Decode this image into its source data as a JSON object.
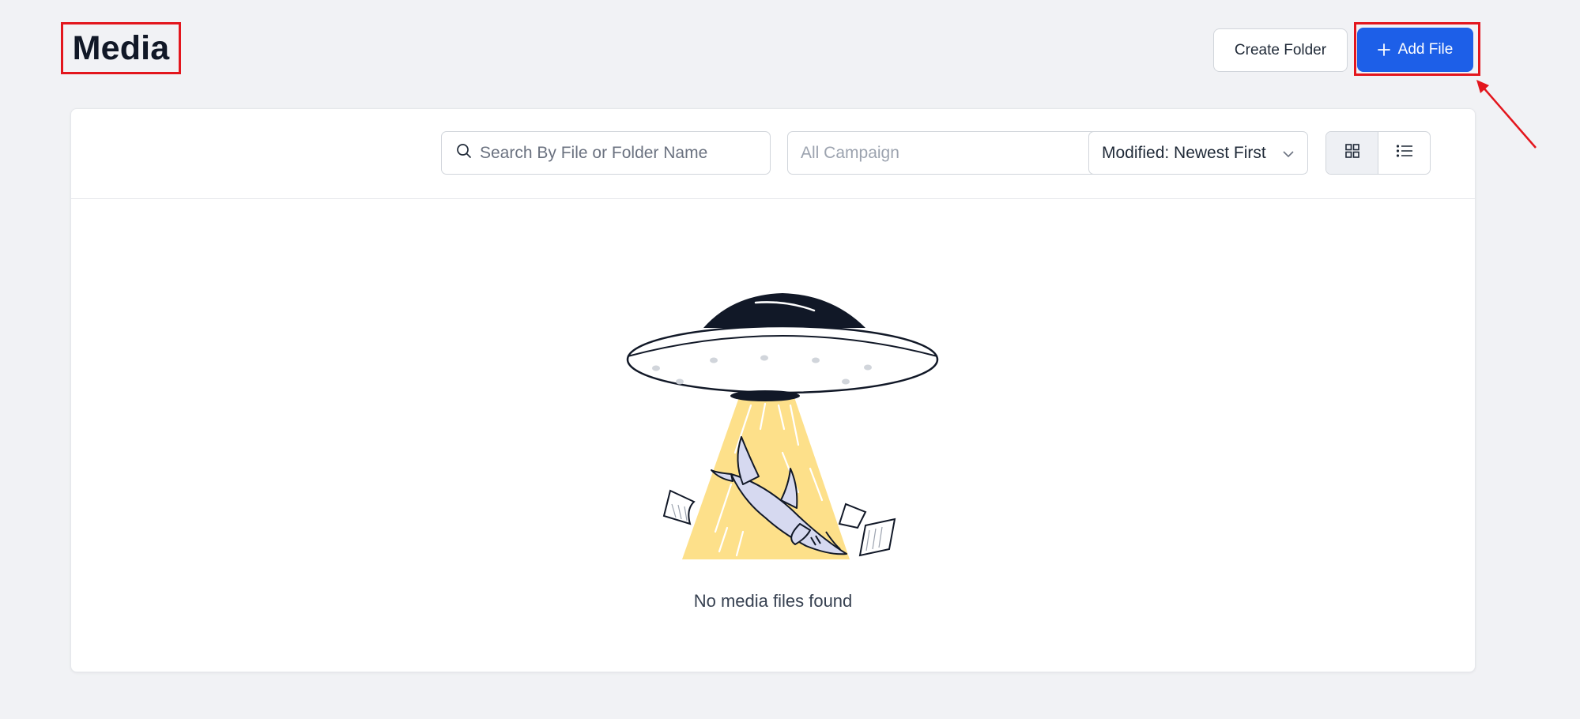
{
  "header": {
    "title": "Media",
    "create_folder_label": "Create Folder",
    "add_file_label": "Add File"
  },
  "toolbar": {
    "search_placeholder": "Search By File or Folder Name",
    "campaign_select": "All Campaign",
    "sort_select": "Modified: Newest First"
  },
  "empty_state": {
    "message": "No media files found"
  },
  "colors": {
    "primary": "#1d5fe8",
    "annotation": "#e3161d",
    "beam": "#fde08a"
  },
  "icons": [
    "search-icon",
    "chevron-down-icon",
    "grid-view-icon",
    "list-view-icon",
    "plus-icon"
  ]
}
